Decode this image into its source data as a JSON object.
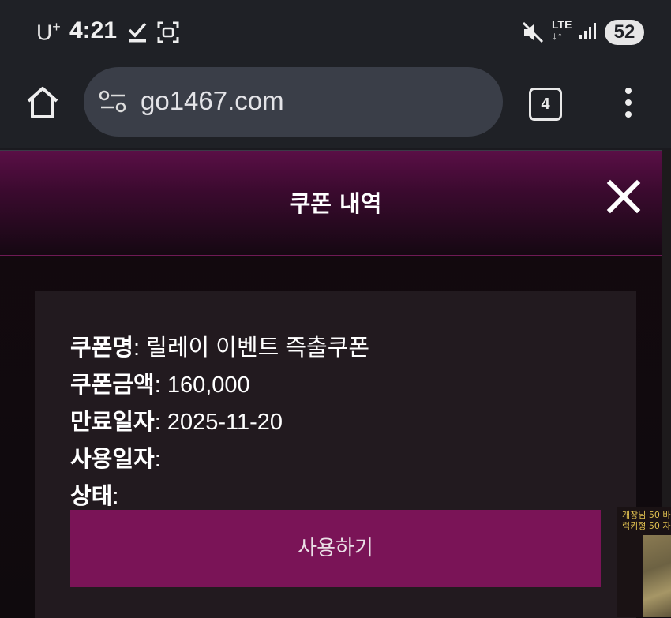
{
  "status_bar": {
    "carrier": "U",
    "carrier_sup": "+",
    "time": "4:21",
    "network": "LTE",
    "battery": "52"
  },
  "browser": {
    "url": "go1467.com",
    "tab_count": "4"
  },
  "modal": {
    "title": "쿠폰 내역",
    "rows": [
      {
        "label": "쿠폰명",
        "value": ": 릴레이 이벤트 즉출쿠폰"
      },
      {
        "label": "쿠폰금액",
        "value": ": 160,000"
      },
      {
        "label": "만료일자",
        "value": ": 2025-11-20"
      },
      {
        "label": "사용일자",
        "value": ":"
      },
      {
        "label": "상태",
        "value": ":"
      }
    ],
    "use_button": "사용하기"
  },
  "side_popup": {
    "line1": "개장님 50 바",
    "line2": "럭키형 50 자"
  }
}
